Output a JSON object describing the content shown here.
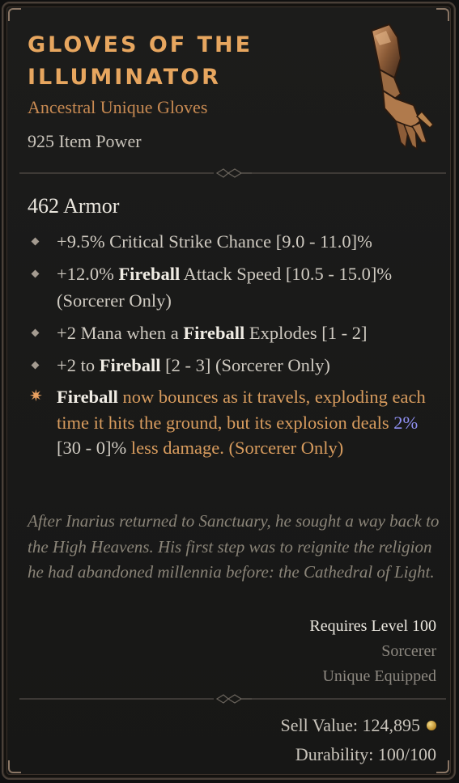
{
  "item": {
    "title_line1": "GLOVES OF THE",
    "title_line2": "ILLUMINATOR",
    "type": "Ancestral Unique Gloves",
    "item_power": "925 Item Power",
    "icon": "gauntlet-glove-icon"
  },
  "stats": {
    "armor": "462 Armor",
    "affixes": [
      {
        "pre": "+9.5% Critical Strike Chance [9.0 - 11.0]%",
        "bold": "",
        "post": ""
      },
      {
        "pre": "+12.0% ",
        "bold": "Fireball",
        "post": " Attack Speed [10.5 - 15.0]% (Sorcerer Only)"
      },
      {
        "pre": "+2 Mana when a ",
        "bold": "Fireball",
        "post": " Explodes [1 - 2]"
      },
      {
        "pre": "+2 to ",
        "bold": "Fireball",
        "post": " [2 - 3] (Sorcerer Only)"
      }
    ],
    "aspect": {
      "bold": "Fireball",
      "text1": " now bounces as it travels, exploding each time it hits the ground, but its explosion deals ",
      "highlight": "2%",
      "range": " [30 - 0]%",
      "text2": " less damage. (Sorcerer Only)"
    }
  },
  "flavor_text": "After Inarius returned to Sanctuary, he sought a way back to the High Heavens. His first step was to reignite the religion he had abandoned millennia before: the Cathedral of Light.",
  "requirements": {
    "level": "Requires Level 100",
    "class": "Sorcerer",
    "unique": "Unique Equipped"
  },
  "footer": {
    "sell_value": "Sell Value: 124,895",
    "durability": "Durability: 100/100",
    "gold_icon": "gold-coin-icon"
  },
  "colors": {
    "title": "#e7a65f",
    "unique_orange": "#d89c5e",
    "highlight_blue": "#8f8ff0",
    "body_text": "#cfcac1",
    "flavor": "#8a8478"
  }
}
